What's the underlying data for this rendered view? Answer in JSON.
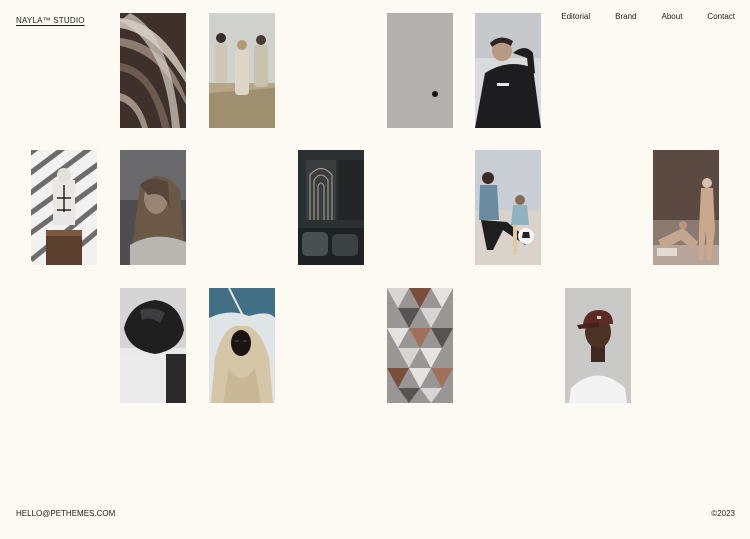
{
  "header": {
    "brand": "NAYLA™ STUDIO",
    "nav": [
      "Editorial",
      "Brand",
      "About",
      "Contact"
    ]
  },
  "footer": {
    "email": "HELLO@PETHEMES.COM",
    "copyright": "©2023"
  },
  "gallery": [
    {
      "row": 1,
      "subject": "spiral-staircase"
    },
    {
      "row": 1,
      "subject": "three-people-field"
    },
    {
      "row": 1,
      "subject": "grey-wall-dot"
    },
    {
      "row": 1,
      "subject": "man-black-hoodie"
    },
    {
      "row": 2,
      "subject": "striped-statue"
    },
    {
      "row": 2,
      "subject": "woman-portrait-dark"
    },
    {
      "row": 2,
      "subject": "dark-interior"
    },
    {
      "row": 2,
      "subject": "soccer-players"
    },
    {
      "row": 2,
      "subject": "two-men-posing"
    },
    {
      "row": 3,
      "subject": "black-rock"
    },
    {
      "row": 3,
      "subject": "masked-figure-sky"
    },
    {
      "row": 3,
      "subject": "geometric-pattern"
    },
    {
      "row": 3,
      "subject": "man-red-cap"
    }
  ]
}
